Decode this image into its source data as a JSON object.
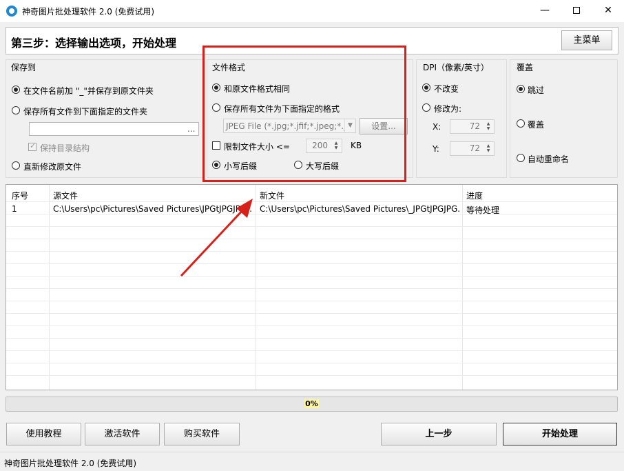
{
  "window": {
    "title": "神奇图片批处理软件 2.0 (免费试用)",
    "minimize": "—",
    "close": "✕"
  },
  "header": {
    "step_title": "第三步：选择输出选项，开始处理",
    "main_menu": "主菜单"
  },
  "save_to": {
    "title": "保存到",
    "option1": "在文件名前加 \"_\"并保存到原文件夹",
    "option2": "保存所有文件到下面指定的文件夹",
    "folder_value": "",
    "browse": "...",
    "keep_structure": "保持目录结构",
    "option3": "直新修改原文件"
  },
  "file_format": {
    "title": "文件格式",
    "option1": "和原文件格式相同",
    "option2": "保存所有文件为下面指定的格式",
    "format_value": "JPEG File (*.jpg;*.jfif;*.jpeg;*.j",
    "settings": "设置...",
    "limit_size": "限制文件大小 <=",
    "size_value": "200",
    "size_unit": "KB",
    "lowercase": "小写后缀",
    "uppercase": "大写后缀"
  },
  "dpi": {
    "title": "DPI（像素/英寸）",
    "unchanged": "不改变",
    "modify": "修改为:",
    "x_label": "X:",
    "x_value": "72",
    "y_label": "Y:",
    "y_value": "72"
  },
  "overwrite": {
    "title": "覆盖",
    "skip": "跳过",
    "overwrite": "覆盖",
    "auto_rename": "自动重命名"
  },
  "table": {
    "headers": [
      "序号",
      "源文件",
      "新文件",
      "进度"
    ],
    "rows": [
      [
        "1",
        "C:\\Users\\pc\\Pictures\\Saved Pictures\\JPGtJPGJPG...",
        "C:\\Users\\pc\\Pictures\\Saved Pictures\\_JPGtJPGJPG...",
        "等待处理"
      ]
    ]
  },
  "progress": {
    "text": "0%",
    "value": 0
  },
  "buttons": {
    "tutorial": "使用教程",
    "activate": "激活软件",
    "buy": "购买软件",
    "prev": "上一步",
    "start": "开始处理"
  },
  "status": {
    "text": "神奇图片批处理软件 2.0 (免费试用)"
  },
  "colors": {
    "highlight": "#d8201a",
    "progress_label_bg": "#fff59d"
  }
}
